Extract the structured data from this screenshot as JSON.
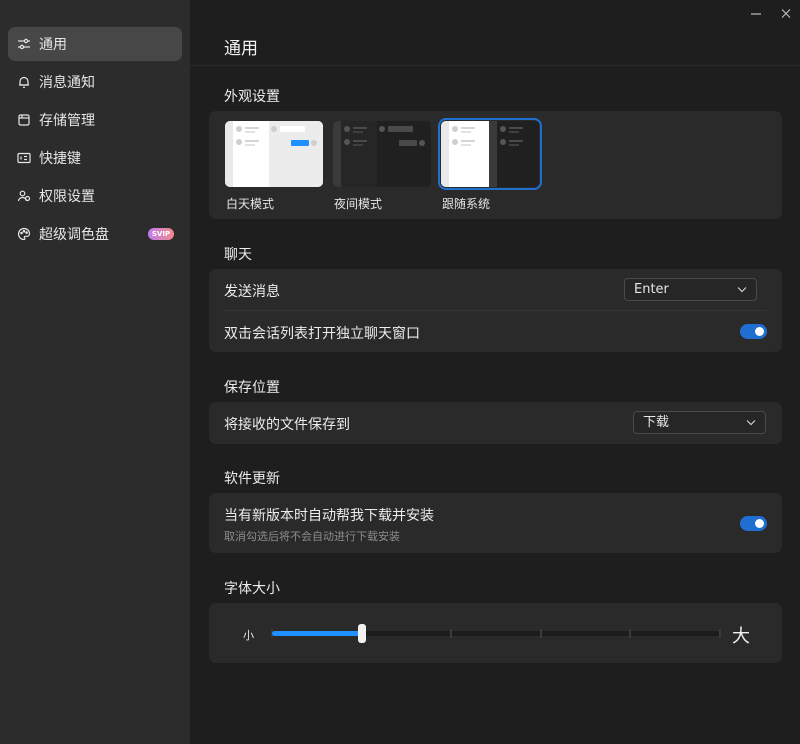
{
  "sidebar": {
    "items": [
      {
        "label": "通用",
        "icon": "sliders-icon",
        "active": true
      },
      {
        "label": "消息通知",
        "icon": "bell-icon"
      },
      {
        "label": "存储管理",
        "icon": "storage-icon"
      },
      {
        "label": "快捷键",
        "icon": "keyboard-icon"
      },
      {
        "label": "权限设置",
        "icon": "users-icon"
      },
      {
        "label": "超级调色盘",
        "icon": "palette-icon",
        "badge": "SVIP"
      }
    ]
  },
  "window": {
    "minimize_icon": "minimize-icon",
    "close_icon": "close-icon"
  },
  "page": {
    "title": "通用"
  },
  "appearance": {
    "section_label": "外观设置",
    "options": [
      {
        "label": "白天模式",
        "theme": "light"
      },
      {
        "label": "夜间模式",
        "theme": "dark"
      },
      {
        "label": "跟随系统",
        "theme": "system",
        "selected": true
      }
    ]
  },
  "chat": {
    "section_label": "聊天",
    "send_label": "发送消息",
    "send_value": "Enter",
    "double_click_label": "双击会话列表打开独立聊天窗口",
    "double_click_on": true
  },
  "save": {
    "section_label": "保存位置",
    "label": "将接收的文件保存到",
    "value": "下载"
  },
  "update": {
    "section_label": "软件更新",
    "label": "当有新版本时自动帮我下载并安装",
    "sub": "取消勾选后将不会自动进行下载安装",
    "on": true
  },
  "font_size": {
    "section_label": "字体大小",
    "small_label": "小",
    "large_label": "大",
    "steps": 6,
    "level": 2
  },
  "colors": {
    "accent": "#1f6fd1",
    "slider": "#1e90ff",
    "sidebar_bg": "#2c2c2c",
    "content_bg": "#1e1e1e",
    "card_bg": "#2a2a2a"
  }
}
